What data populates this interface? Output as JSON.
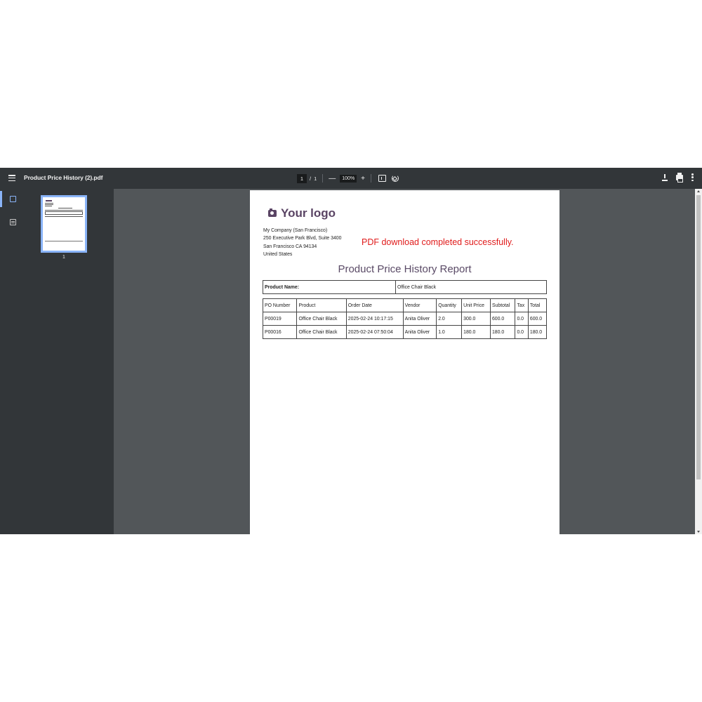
{
  "toolbar": {
    "title": "Product Price History (2).pdf",
    "page_current": "1",
    "page_separator": "/",
    "page_total": "1",
    "zoom_out": "—",
    "zoom": "100%",
    "zoom_in": "+"
  },
  "sidebar": {
    "thumbnail_page_number": "1"
  },
  "document": {
    "logo_text": "Your logo",
    "company_lines": [
      "My Company (San Francisco)",
      "250 Executive Park Blvd, Suite 3400",
      "San Francisco CA 94134",
      "United States"
    ],
    "status_message": "PDF download completed successfully.",
    "report_title": "Product Price History Report",
    "product_label": "Product Name:",
    "product_value": "Office Chair Black",
    "table": {
      "headers": [
        "PO Number",
        "Product",
        "Order Date",
        "Vendor",
        "Quantity",
        "Unit Price",
        "Subtotal",
        "Tax",
        "Total"
      ],
      "rows": [
        [
          "P00019",
          "Office Chair Black",
          "2025-02-24 10:17:15",
          "Anita Oliver",
          "2.0",
          "300.0",
          "600.0",
          "0.0",
          "600.0"
        ],
        [
          "P00016",
          "Office Chair Black",
          "2025-02-24 07:50:04",
          "Anita Oliver",
          "1.0",
          "180.0",
          "180.0",
          "0.0",
          "180.0"
        ]
      ]
    }
  },
  "colors": {
    "toolbar_bg": "#323639",
    "viewer_bg": "#525659",
    "accent": "#8ab4f8",
    "logo": "#5a4464",
    "status_text": "#e01b1b"
  }
}
